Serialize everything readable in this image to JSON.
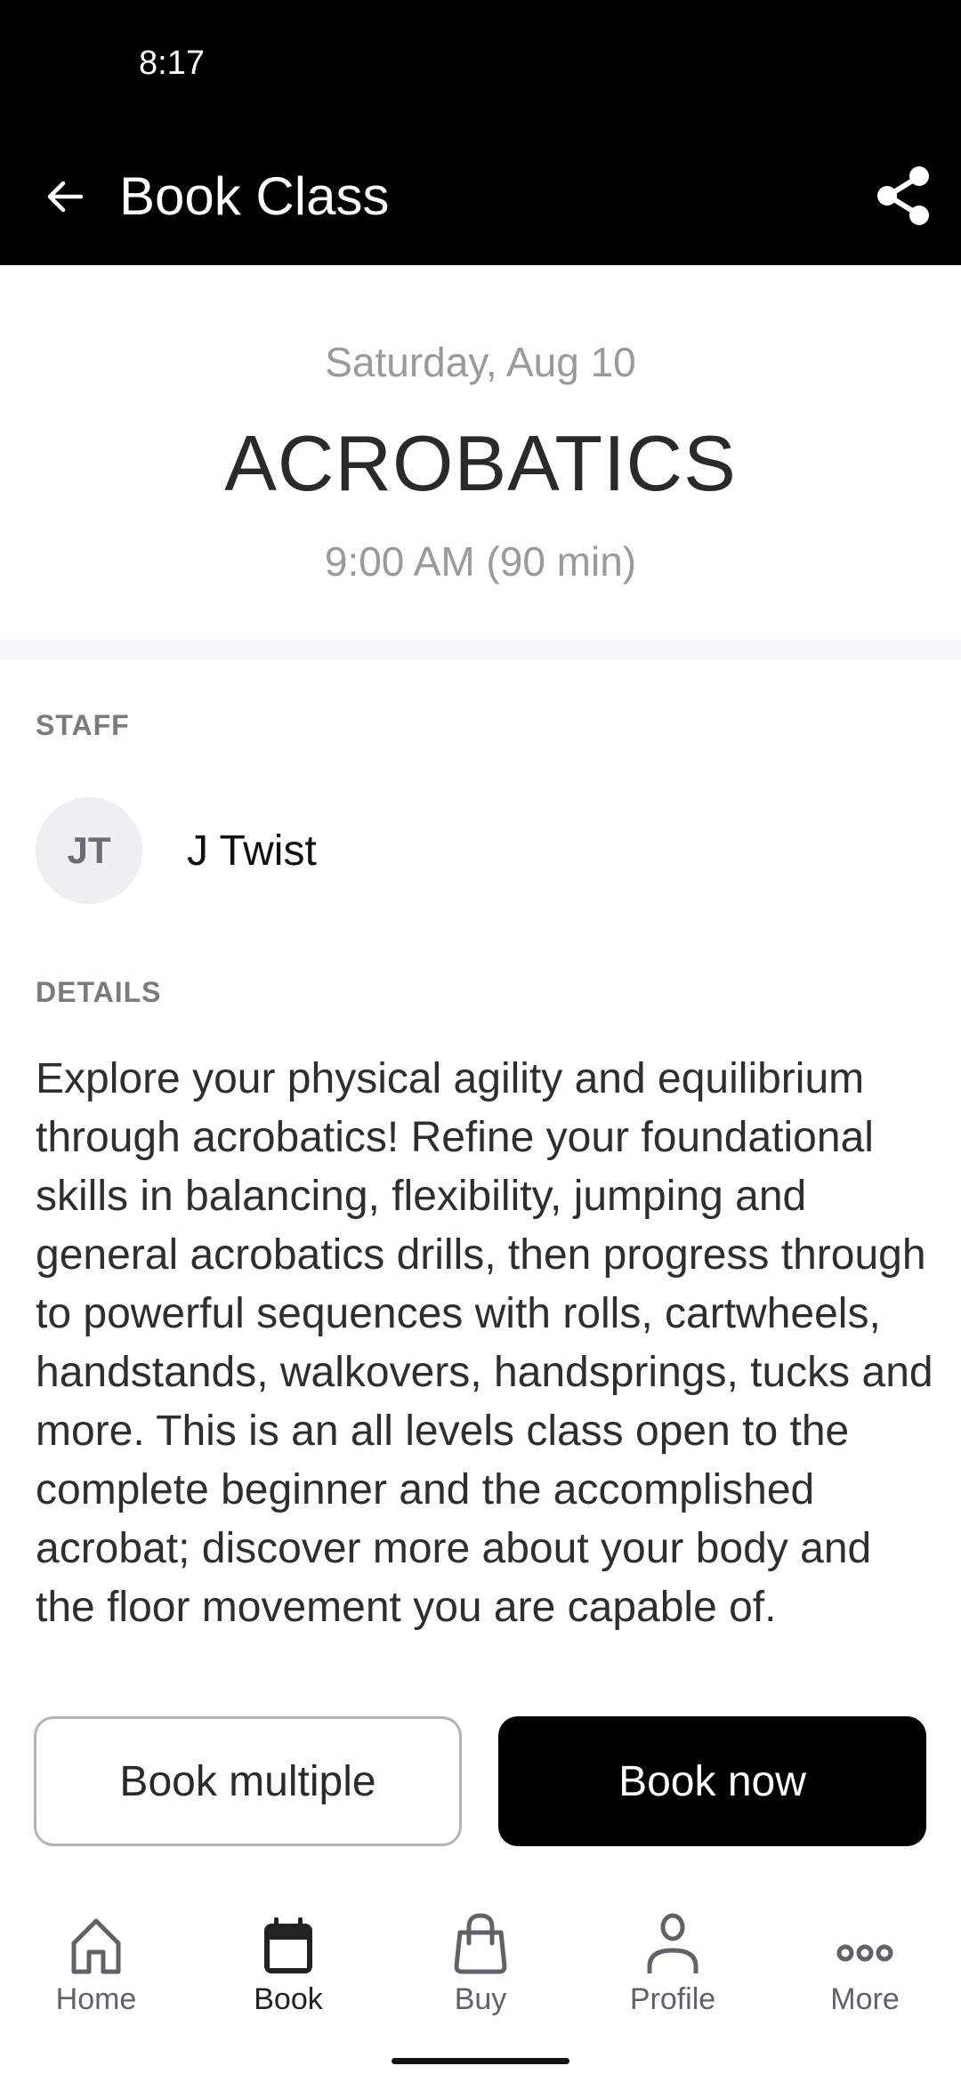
{
  "status_bar": {
    "time": "8:17"
  },
  "app_bar": {
    "title": "Book Class",
    "back_icon": "arrow-left-icon",
    "share_icon": "share-icon"
  },
  "class": {
    "date": "Saturday, Aug 10",
    "name": "ACROBATICS",
    "time": "9:00 AM (90 min)"
  },
  "staff": {
    "label": "STAFF",
    "initials": "JT",
    "name": "J Twist"
  },
  "details": {
    "label": "DETAILS",
    "text": "Explore your physical agility and equilibrium through acrobatics! Refine your foundational skills in balancing, flexibility, jumping and general acrobatics drills, then progress through to powerful sequences with rolls, cartwheels, handstands, walkovers, handsprings, tucks and more. This is an all levels class open to the complete beginner and the accomplished acrobat; discover more about your body and the floor movement you are capable of."
  },
  "actions": {
    "book_multiple": "Book multiple",
    "book_now": "Book now"
  },
  "tabs": [
    {
      "label": "Home",
      "icon": "home-icon",
      "active": false
    },
    {
      "label": "Book",
      "icon": "calendar-icon",
      "active": true
    },
    {
      "label": "Buy",
      "icon": "shopping-bag-icon",
      "active": false
    },
    {
      "label": "Profile",
      "icon": "person-icon",
      "active": false
    },
    {
      "label": "More",
      "icon": "more-dots-icon",
      "active": false
    }
  ],
  "colors": {
    "app_bar_bg": "#000000",
    "primary_button_bg": "#000000",
    "muted_text": "#9a9a9a",
    "section_label": "#7b7b7b",
    "avatar_bg": "#eff0f2",
    "separator": "#f6f7f9"
  }
}
